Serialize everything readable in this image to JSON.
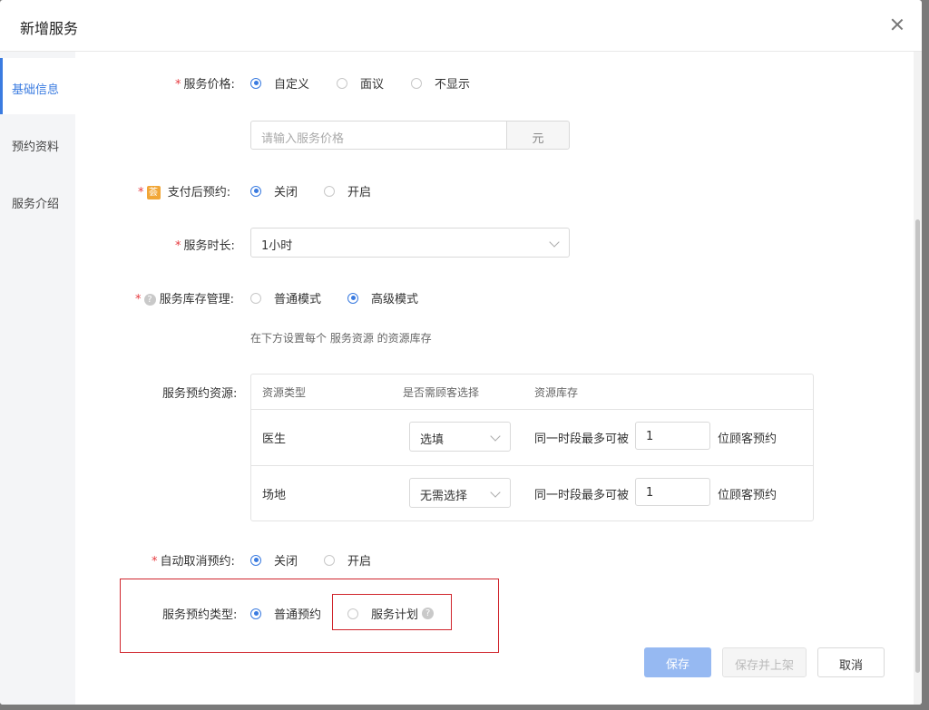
{
  "dialog": {
    "title": "新增服务"
  },
  "sidebar": {
    "items": [
      {
        "label": "基础信息"
      },
      {
        "label": "预约资料"
      },
      {
        "label": "服务介绍"
      }
    ]
  },
  "required_mark": "*",
  "price": {
    "label": "服务价格:",
    "options": [
      "自定义",
      "面议",
      "不显示"
    ],
    "selected": "自定义",
    "placeholder": "请输入服务价格",
    "unit": "元"
  },
  "pay_first": {
    "badge": "荟",
    "label": "支付后预约:",
    "options": [
      "关闭",
      "开启"
    ],
    "selected": "关闭"
  },
  "duration": {
    "label": "服务时长:",
    "value": "1小时"
  },
  "inventory": {
    "help": "?",
    "label": "服务库存管理:",
    "options": [
      "普通模式",
      "高级模式"
    ],
    "selected": "高级模式",
    "hint": "在下方设置每个 服务资源 的资源库存"
  },
  "resources": {
    "label": "服务预约资源:",
    "headers": [
      "资源类型",
      "是否需顾客选择",
      "资源库存"
    ],
    "rows": [
      {
        "type": "医生",
        "select": "选填",
        "stock_prefix": "同一时段最多可被",
        "stock": "1",
        "stock_suffix": "位顾客预约"
      },
      {
        "type": "场地",
        "select": "无需选择",
        "stock_prefix": "同一时段最多可被",
        "stock": "1",
        "stock_suffix": "位顾客预约"
      }
    ]
  },
  "auto_cancel": {
    "label": "自动取消预约:",
    "options": [
      "关闭",
      "开启"
    ],
    "selected": "关闭"
  },
  "booking_type": {
    "label": "服务预约类型:",
    "options": [
      "普通预约",
      "服务计划"
    ],
    "selected": "普通预约",
    "help": "?"
  },
  "footer": {
    "save": "保存",
    "save_publish": "保存并上架",
    "cancel": "取消"
  },
  "colors": {
    "primary": "#3a7be0",
    "required": "#e6393e",
    "highlight": "#d0252c",
    "badge": "#f1a636"
  }
}
